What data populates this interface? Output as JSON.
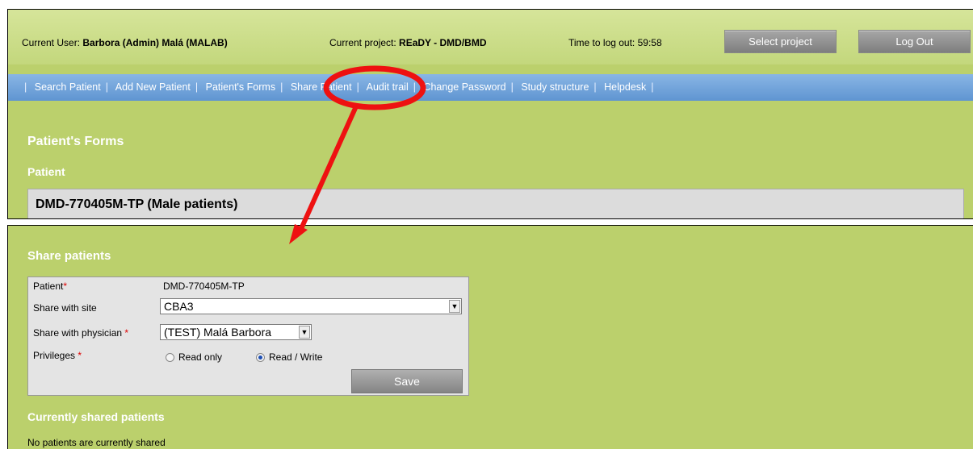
{
  "header": {
    "current_user_label": "Current User:",
    "current_user_value": "Barbora (Admin) Malá (MALAB)",
    "current_project_label": "Current project:",
    "current_project_value": "REaDY - DMD/BMD",
    "logout_timer": "Time to log out: 59:58",
    "select_project_button": "Select project",
    "logout_button": "Log Out"
  },
  "nav": {
    "items": [
      "Search Patient",
      "Add New Patient",
      "Patient's Forms",
      "Share Patient",
      "Audit trail",
      "Change Password",
      "Study structure",
      "Helpdesk"
    ]
  },
  "patient_forms": {
    "title": "Patient's Forms",
    "subtitle": "Patient",
    "patient_name": "DMD-770405M-TP (Male patients)"
  },
  "share": {
    "title": "Share patients",
    "patient_label": "Patient",
    "patient_value": "DMD-770405M-TP",
    "site_label": "Share with site",
    "site_value": "CBA3",
    "physician_label": "Share with physician",
    "physician_value": "(TEST) Malá Barbora",
    "privileges_label": "Privileges",
    "privilege_options": [
      "Read only",
      "Read / Write"
    ],
    "selected_privilege": "Read / Write",
    "save_button": "Save",
    "required_marker": "*"
  },
  "currently_shared": {
    "title": "Currently shared patients",
    "empty_message": "No patients are currently shared"
  },
  "colors": {
    "panel_green": "#bbd06c",
    "nav_blue": "#6f9fd8",
    "annotation_red": "#ee1111"
  }
}
